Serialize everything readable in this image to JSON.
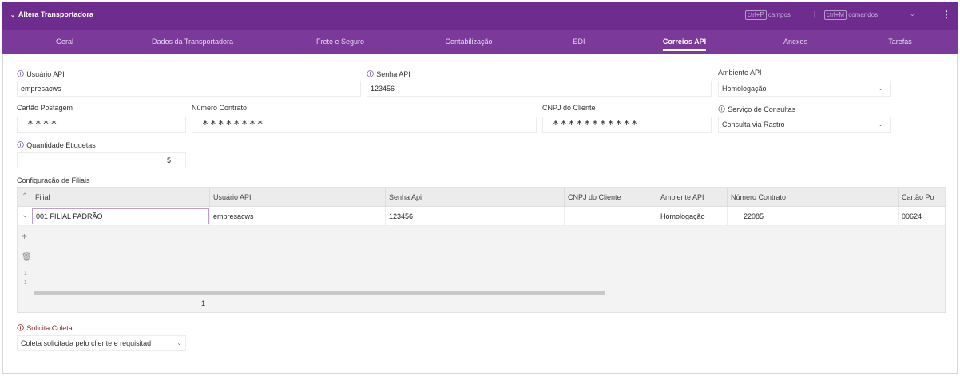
{
  "window": {
    "title": "Altera Transportadora",
    "shortcut_fields_key": "ctrl+P",
    "shortcut_fields_label": "campos",
    "shortcut_sep": "|",
    "shortcut_cmds_key": "ctrl+M",
    "shortcut_cmds_label": "comandos",
    "chevron": "⌄",
    "menu_glyph": "⋮"
  },
  "tabs": [
    {
      "label": "Geral"
    },
    {
      "label": "Dados da Transportadora"
    },
    {
      "label": "Frete e Seguro"
    },
    {
      "label": "Contabilização"
    },
    {
      "label": "EDI"
    },
    {
      "label": "Correios API"
    },
    {
      "label": "Anexos"
    },
    {
      "label": "Tarefas"
    }
  ],
  "active_tab": "Correios API",
  "form": {
    "usuario_api": {
      "label": "Usuário API",
      "value": "empresacws"
    },
    "senha_api": {
      "label": "Senha API",
      "value": "123456"
    },
    "ambiente_api": {
      "label": "Ambiente API",
      "value": "Homologação"
    },
    "cartao_postagem": {
      "label": "Cartão Postagem",
      "value": "****"
    },
    "numero_contrato": {
      "label": "Número Contrato",
      "value": "********"
    },
    "cnpj_cliente": {
      "label": "CNPJ do Cliente",
      "value": "***********"
    },
    "servico_consultas": {
      "label": "Serviço de Consultas",
      "value": "Consulta via Rastro"
    },
    "quantidade_etiquetas": {
      "label": "Quantidade Etiquetas",
      "value": "5"
    },
    "config_filiais_label": "Configuração de Filiais",
    "solicita_coleta": {
      "label": "Solicita Coleta",
      "value": "Coleta solicitada pelo cliente e requisitad"
    }
  },
  "grid": {
    "columns": [
      "Filial",
      "Usuário API",
      "Senha Api",
      "CNPJ do Cliente",
      "Ambiente API",
      "Número Contrato",
      "Cartão Po"
    ],
    "rows": [
      [
        "001 FILIAL PADRÃO",
        "empresacws",
        "123456",
        "",
        "Homologação",
        "22085",
        "00624"
      ]
    ],
    "row_numbers": [
      "1",
      "1"
    ],
    "page": "1"
  },
  "icons": {
    "info": "🛈",
    "sort_up": "⌃",
    "expand": "⌄",
    "add": "+",
    "delete": "🗑",
    "chevron": "⌄"
  },
  "colors": {
    "titlebar": "#6d2c8e",
    "tabbar": "#7b3a9a"
  }
}
